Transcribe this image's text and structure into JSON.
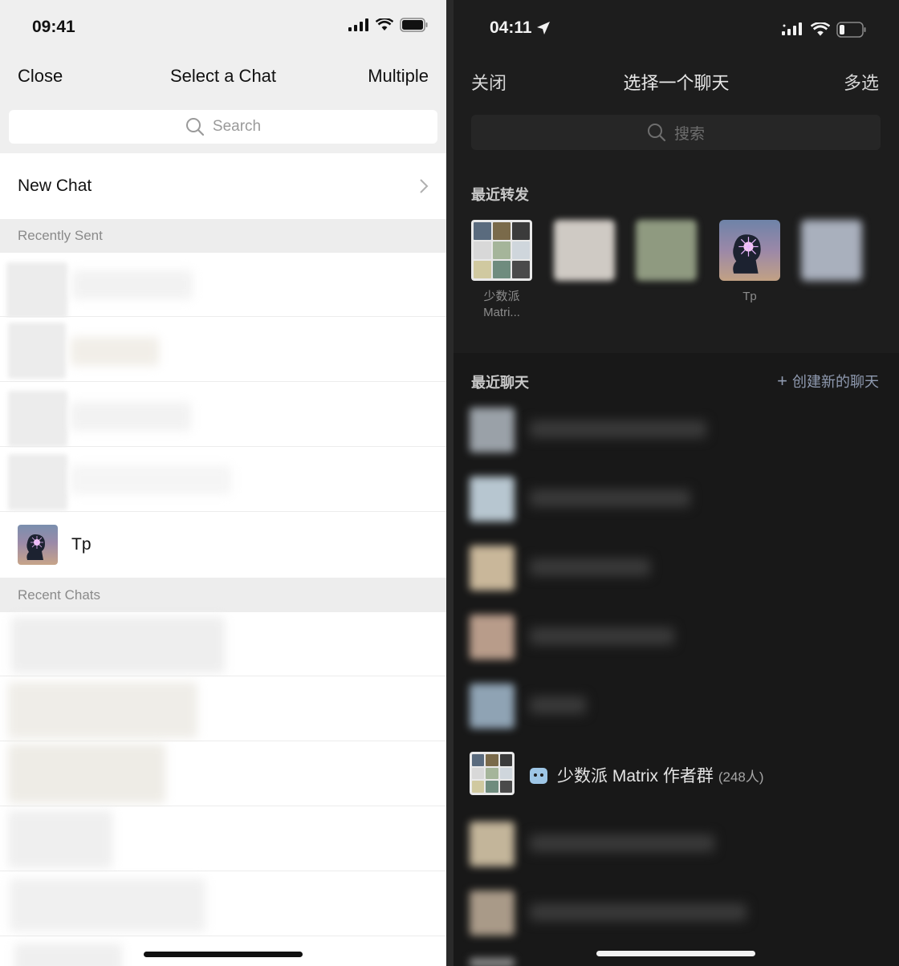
{
  "left": {
    "status_time": "09:41",
    "nav": {
      "close": "Close",
      "title": "Select a Chat",
      "multiple": "Multiple"
    },
    "search_placeholder": "Search",
    "new_chat": "New Chat",
    "recently_sent_header": "Recently Sent",
    "tp_name": "Tp",
    "recent_chats_header": "Recent Chats"
  },
  "right": {
    "status_time": "04:11",
    "nav": {
      "close": "关闭",
      "title": "选择一个聊天",
      "multiple": "多选"
    },
    "search_placeholder": "搜索",
    "recent_forward_header": "最近转发",
    "recent_tiles": [
      {
        "label": "少数派 Matri..."
      },
      {
        "label": "Tp"
      }
    ],
    "recent_chats_header": "最近聊天",
    "create_new_chat": "创建新的聊天",
    "matrix_group_name": "少数派 Matrix 作者群",
    "matrix_group_count": "(248人)"
  },
  "colors": {
    "light_bg": "#efefef",
    "dark_bg": "#1d1d1d",
    "accent_link_dark": "#8f9ab0"
  }
}
